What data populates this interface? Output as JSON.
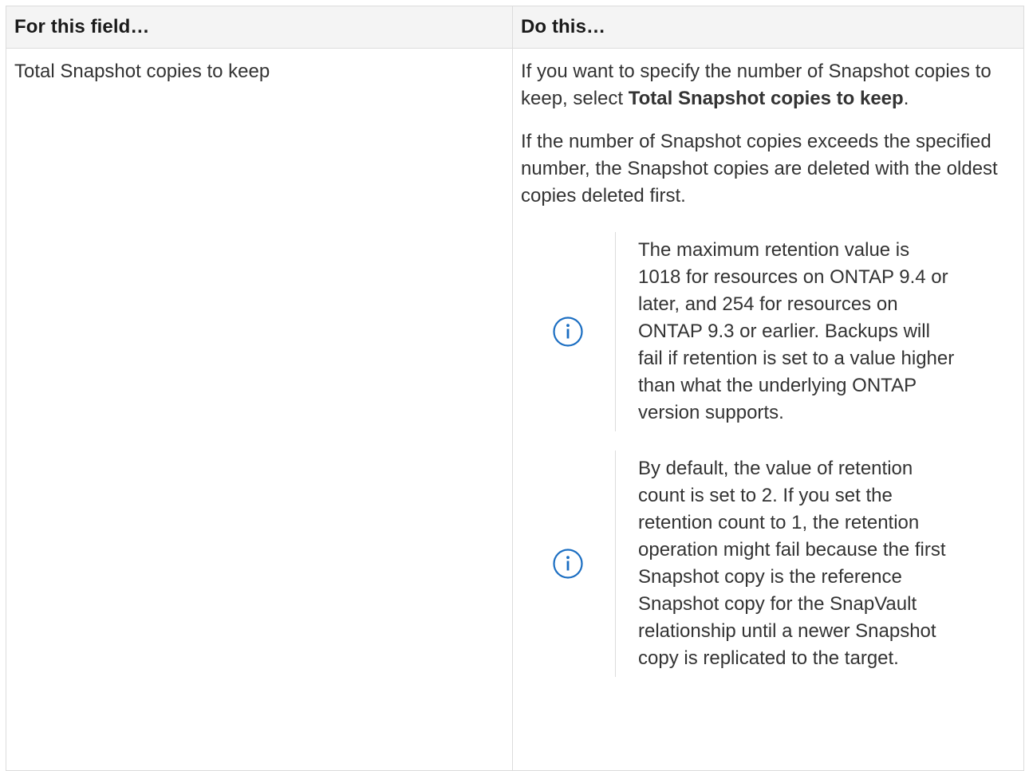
{
  "table": {
    "headers": {
      "field": "For this field…",
      "action": "Do this…"
    },
    "row": {
      "field": "Total Snapshot copies to keep",
      "para1": {
        "before": "If you want to specify the number of Snapshot copies to keep, select ",
        "bold": "Total Snapshot copies to keep",
        "after": "."
      },
      "para2": "If the number of Snapshot copies exceeds the specified number, the Snapshot copies are deleted with the oldest copies deleted first.",
      "notes": [
        {
          "icon": "info-icon",
          "text": "The maximum retention value is 1018 for resources on ONTAP 9.4 or later, and 254 for resources on ONTAP 9.3 or earlier. Backups will fail if retention is set to a value higher than what the underlying ONTAP version supports."
        },
        {
          "icon": "info-icon",
          "text": "By default, the value of retention count is set to 2. If you set the retention count to 1, the retention operation might fail because the first Snapshot copy is the reference Snapshot copy for the SnapVault relationship until a newer Snapshot copy is replicated to the target."
        }
      ]
    }
  },
  "colors": {
    "icon": "#1b6ec2",
    "border": "#dcdcdc",
    "header_bg": "#f4f4f4",
    "text": "#333333"
  }
}
